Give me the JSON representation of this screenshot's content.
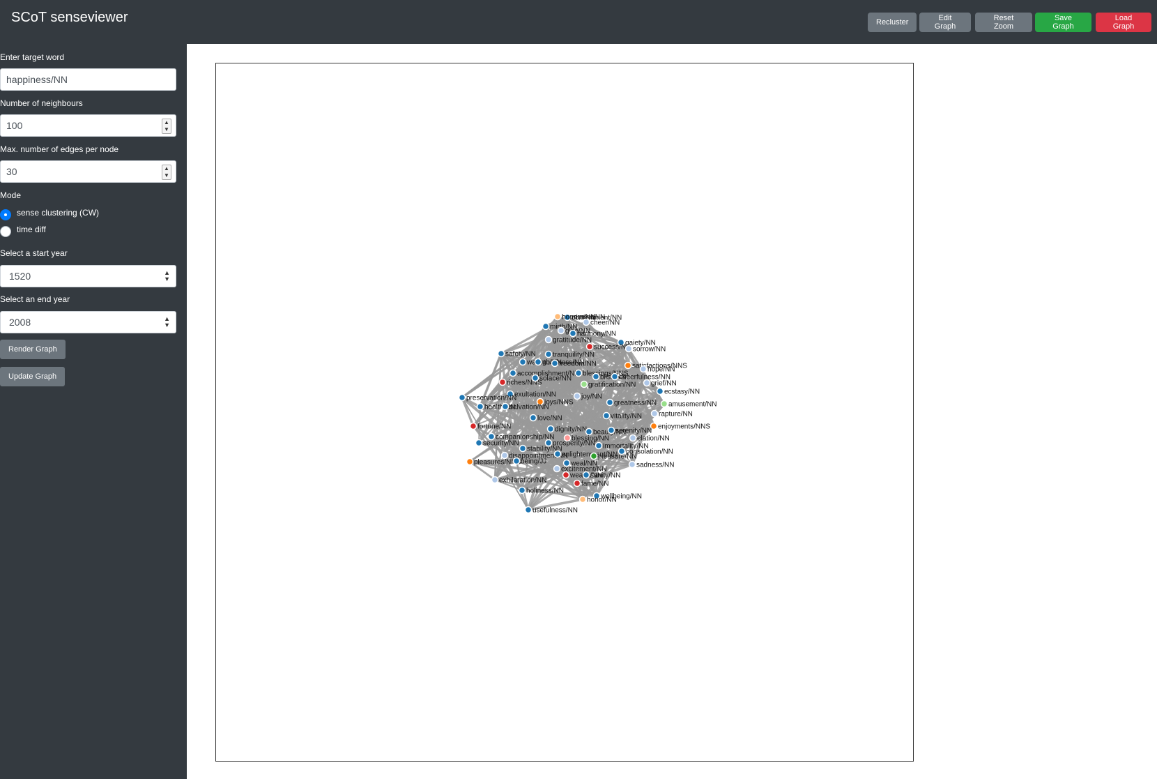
{
  "app": {
    "title": "SCoT senseviewer"
  },
  "toolbar": {
    "recluster": "Recluster",
    "edit_graph": "Edit Graph",
    "reset_zoom": "Reset Zoom",
    "save_graph": "Save Graph",
    "load_graph": "Load Graph"
  },
  "sidebar": {
    "target_label": "Enter target word",
    "target_value": "happiness/NN",
    "neighbours_label": "Number of neighbours",
    "neighbours_value": "100",
    "edges_label": "Max. number of edges per node",
    "edges_value": "30",
    "mode_label": "Mode",
    "mode_options": [
      "sense clustering (CW)",
      "time diff"
    ],
    "mode_selected": "sense clustering (CW)",
    "start_label": "Select a start year",
    "start_value": "1520",
    "end_label": "Select an end year",
    "end_value": "2008",
    "render_button": "Render Graph",
    "update_button": "Update Graph"
  },
  "graph": {
    "colors": {
      "dark_blue": "#1f77b4",
      "light_blue": "#aec7e8",
      "red": "#d62728",
      "orange": "#ff7f0e",
      "light_orange": "#ffbb78",
      "light_green": "#98df8a",
      "green": "#2ca02c",
      "pink": "#ff9896",
      "edge": "#999999"
    },
    "nodes": [
      {
        "label": "merriment/NN",
        "color": "light_blue"
      },
      {
        "label": "contentment/NN",
        "color": "dark_blue"
      },
      {
        "label": "cheer/NN",
        "color": "light_blue"
      },
      {
        "label": "mirth/NN",
        "color": "dark_blue"
      },
      {
        "label": "glee/NN",
        "color": "light_blue"
      },
      {
        "label": "harmony/NN",
        "color": "dark_blue"
      },
      {
        "label": "gratitude/NN",
        "color": "light_blue"
      },
      {
        "label": "gaiety/NN",
        "color": "dark_blue"
      },
      {
        "label": "success/NN",
        "color": "red"
      },
      {
        "label": "sorrow/NN",
        "color": "light_blue"
      },
      {
        "label": "safety/NN",
        "color": "dark_blue"
      },
      {
        "label": "tranquility/NN",
        "color": "dark_blue"
      },
      {
        "label": "warmth/NN",
        "color": "dark_blue"
      },
      {
        "label": "goodness/NN",
        "color": "dark_blue"
      },
      {
        "label": "freedom/NN",
        "color": "dark_blue"
      },
      {
        "label": "satisfactions/NNS",
        "color": "orange"
      },
      {
        "label": "hope/NN",
        "color": "light_blue"
      },
      {
        "label": "accomplishment/NN",
        "color": "dark_blue"
      },
      {
        "label": "blessings/NNS",
        "color": "dark_blue"
      },
      {
        "label": "bliss/NN",
        "color": "dark_blue"
      },
      {
        "label": "cheerfulness/NN",
        "color": "dark_blue"
      },
      {
        "label": "riches/NNS",
        "color": "red"
      },
      {
        "label": "solace/NN",
        "color": "dark_blue"
      },
      {
        "label": "grief/NN",
        "color": "light_blue"
      },
      {
        "label": "gratification/NN",
        "color": "light_green"
      },
      {
        "label": "ecstasy/NN",
        "color": "dark_blue"
      },
      {
        "label": "exultation/NN",
        "color": "dark_blue"
      },
      {
        "label": "joy/NN",
        "color": "light_blue"
      },
      {
        "label": "preservation/NN",
        "color": "dark_blue"
      },
      {
        "label": "joys/NNS",
        "color": "orange"
      },
      {
        "label": "greatness/NN",
        "color": "dark_blue"
      },
      {
        "label": "amusement/NN",
        "color": "light_green"
      },
      {
        "label": "health/NN",
        "color": "dark_blue"
      },
      {
        "label": "salvation/NN",
        "color": "dark_blue"
      },
      {
        "label": "rapture/NN",
        "color": "light_blue"
      },
      {
        "label": "love/NN",
        "color": "dark_blue"
      },
      {
        "label": "vitality/NN",
        "color": "dark_blue"
      },
      {
        "label": "fortune/NN",
        "color": "red"
      },
      {
        "label": "enjoyments/NNS",
        "color": "orange"
      },
      {
        "label": "dignity/NN",
        "color": "dark_blue"
      },
      {
        "label": "beauty/NN",
        "color": "dark_blue"
      },
      {
        "label": "serenity/NN",
        "color": "dark_blue"
      },
      {
        "label": "companionship/NN",
        "color": "dark_blue"
      },
      {
        "label": "blessing/NN",
        "color": "pink"
      },
      {
        "label": "elation/NN",
        "color": "light_blue"
      },
      {
        "label": "security/NN",
        "color": "dark_blue"
      },
      {
        "label": "prosperity/NN",
        "color": "dark_blue"
      },
      {
        "label": "immortality/NN",
        "color": "dark_blue"
      },
      {
        "label": "stability/NN",
        "color": "dark_blue"
      },
      {
        "label": "consolation/NN",
        "color": "dark_blue"
      },
      {
        "label": "disappointment/NN",
        "color": "light_blue"
      },
      {
        "label": "enlightenment/NN",
        "color": "dark_blue"
      },
      {
        "label": "pleasure/NN",
        "color": "green"
      },
      {
        "label": "pleasures/NNS",
        "color": "orange"
      },
      {
        "label": "being/JJ",
        "color": "dark_blue"
      },
      {
        "label": "weal/NN",
        "color": "dark_blue"
      },
      {
        "label": "sadness/NN",
        "color": "light_blue"
      },
      {
        "label": "excitement/NN",
        "color": "light_blue"
      },
      {
        "label": "exhilaration/NN",
        "color": "light_blue"
      },
      {
        "label": "wealth/NN",
        "color": "red"
      },
      {
        "label": "sanity/NN",
        "color": "dark_blue"
      },
      {
        "label": "fame/NN",
        "color": "red"
      },
      {
        "label": "holiness/NN",
        "color": "dark_blue"
      },
      {
        "label": "wellbeing/NN",
        "color": "dark_blue"
      },
      {
        "label": "honor/NN",
        "color": "light_orange"
      },
      {
        "label": "usefulness/NN",
        "color": "dark_blue"
      },
      {
        "label": "honour/NN",
        "color": "light_orange"
      }
    ]
  }
}
